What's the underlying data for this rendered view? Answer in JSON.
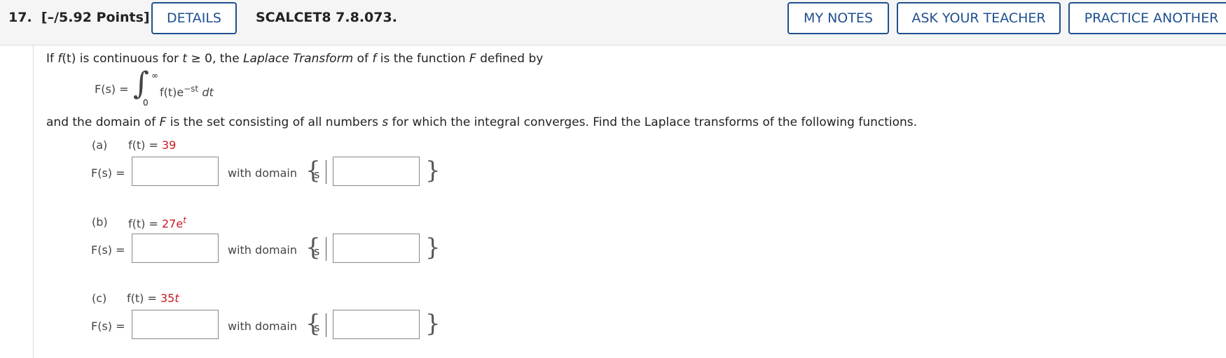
{
  "header": {
    "question_number": "17.",
    "points": "[–/5.92 Points]",
    "details_label": "DETAILS",
    "code": "SCALCET8 7.8.073.",
    "my_notes_label": "MY NOTES",
    "ask_teacher_label": "ASK YOUR TEACHER",
    "practice_label": "PRACTICE ANOTHER"
  },
  "problem": {
    "intro_1": "If ",
    "intro_f": "f",
    "intro_t": "(t)",
    "intro_2": " is continuous for ",
    "intro_tvar": "t",
    "intro_3": " ≥ 0, the ",
    "intro_lt": "Laplace Transform",
    "intro_4": " of ",
    "intro_f2": "f",
    "intro_5": " is the function ",
    "intro_F": "F",
    "intro_6": " defined by",
    "def_lhs": "F(s) =",
    "int_upper": "∞",
    "int_lower": "0",
    "integrand": "f(t)e",
    "exponent": "−st",
    "dt": " dt",
    "domain_1": "and the domain of ",
    "domain_F": "F",
    "domain_2": " is the set consisting of all numbers ",
    "domain_s": "s",
    "domain_3": " for which the integral converges. Find the Laplace transforms of the following functions."
  },
  "parts": [
    {
      "label": "(a)",
      "lhs": "f(t) =",
      "rhs": "39",
      "sup": "",
      "rhs_suffix": "",
      "ans_label": "F(s) =",
      "with_domain": "with domain",
      "set_var": "s",
      "answer_value": "",
      "domain_value": ""
    },
    {
      "label": "(b)",
      "lhs": "f(t) =",
      "rhs": "27e",
      "sup": "t",
      "rhs_suffix": "",
      "ans_label": "F(s) =",
      "with_domain": "with domain",
      "set_var": "s",
      "answer_value": "",
      "domain_value": ""
    },
    {
      "label": "(c)",
      "lhs": "f(t) =",
      "rhs": "35",
      "sup": "",
      "rhs_suffix": "t",
      "ans_label": "F(s) =",
      "with_domain": "with domain",
      "set_var": "s",
      "answer_value": "",
      "domain_value": ""
    }
  ],
  "colors": {
    "accent": "#1f4f8f",
    "given_value": "#c8191f",
    "header_bg": "#f5f5f5"
  }
}
